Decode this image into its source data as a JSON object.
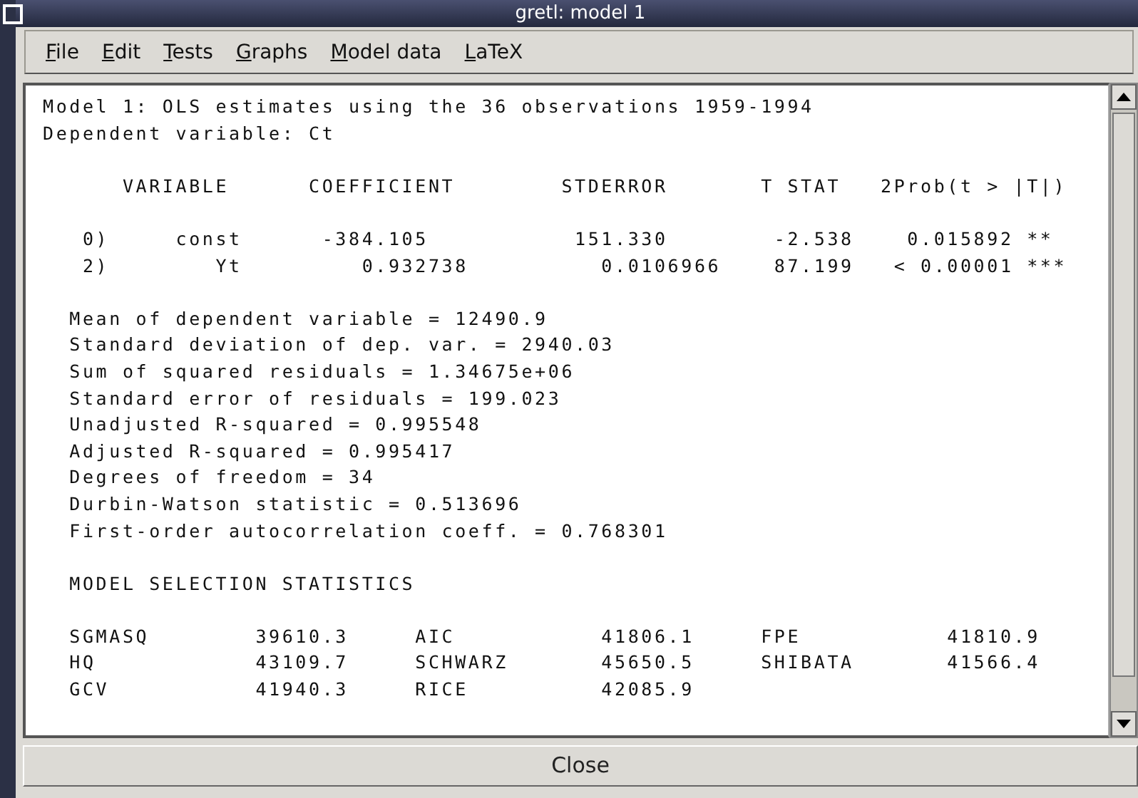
{
  "window": {
    "title": "gretl: model 1"
  },
  "menu": [
    "File",
    "Edit",
    "Tests",
    "Graphs",
    "Model data",
    "LaTeX"
  ],
  "output_blocks": [
    {
      "lines": [
        "Model 1: OLS estimates using the 36 observations 1959-1994",
        "Dependent variable: Ct"
      ]
    },
    {
      "lines": [
        "      VARIABLE      COEFFICIENT        STDERROR       T STAT   2Prob(t > |T|)"
      ]
    },
    {
      "lines": [
        "   0)     const      -384.105           151.330        -2.538    0.015892 **",
        "   2)        Yt         0.932738          0.0106966    87.199   < 0.00001 ***"
      ]
    },
    {
      "lines": [
        "  Mean of dependent variable = 12490.9",
        "  Standard deviation of dep. var. = 2940.03",
        "  Sum of squared residuals = 1.34675e+06",
        "  Standard error of residuals = 199.023",
        "  Unadjusted R-squared = 0.995548",
        "  Adjusted R-squared = 0.995417",
        "  Degrees of freedom = 34",
        "  Durbin-Watson statistic = 0.513696",
        "  First-order autocorrelation coeff. = 0.768301"
      ]
    },
    {
      "lines": [
        "  MODEL SELECTION STATISTICS"
      ]
    },
    {
      "lines": [
        "  SGMASQ        39610.3     AIC           41806.1     FPE           41810.9",
        "  HQ            43109.7     SCHWARZ       45650.5     SHIBATA       41566.4",
        "  GCV           41940.3     RICE          42085.9"
      ]
    }
  ],
  "buttons": [
    "Close"
  ]
}
